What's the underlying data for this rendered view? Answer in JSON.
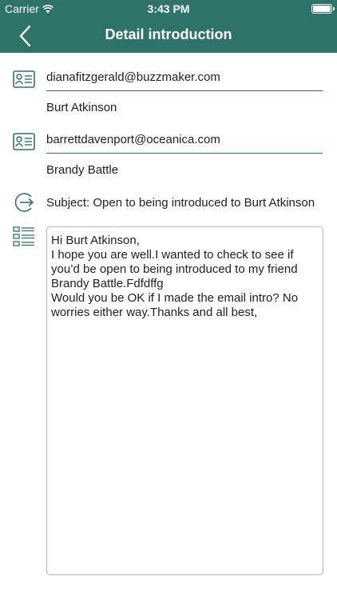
{
  "status_bar": {
    "carrier": "Carrier",
    "time": "3:43 PM",
    "battery_level": 1.0
  },
  "header": {
    "title": "Detail introduction",
    "back_icon": "chevron-left-icon",
    "color": "#2e7367"
  },
  "contacts": [
    {
      "icon": "contact-card-icon",
      "email": "dianafitzgerald@buzzmaker.com",
      "name": "Burt Atkinson"
    },
    {
      "icon": "contact-card-icon",
      "email": "barrettdavenport@oceanica.com",
      "name": "Brandy Battle"
    }
  ],
  "subject": {
    "icon": "arrow-circle-icon",
    "text": "Subject: Open to being introduced to Burt Atkinson"
  },
  "message": {
    "icon": "message-list-icon",
    "text": "Hi Burt Atkinson,\nI hope you are well.I wanted to check to see if you’d be open to being introduced to my friend Brandy Battle.Fdfdffg\nWould you be OK if I made the email intro? No worries either way.Thanks and all best,"
  }
}
